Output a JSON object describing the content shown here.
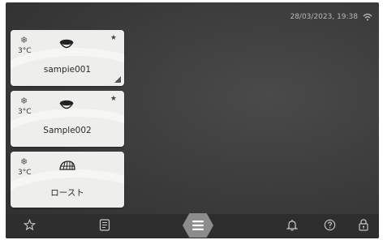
{
  "status_bar": {
    "datetime": "28/03/2023, 19:38",
    "connection_icon": "wifi-icon"
  },
  "cards": [
    {
      "temp": "3°C",
      "name": "sampie001",
      "icon": "bowl-icon",
      "favorite": true,
      "corner_marker": true
    },
    {
      "temp": "3°C",
      "name": "Sample002",
      "icon": "bowl-icon",
      "favorite": true,
      "corner_marker": false
    },
    {
      "temp": "3°C",
      "name": "ロースト",
      "icon": "roast-icon",
      "favorite": false,
      "corner_marker": false
    }
  ],
  "bottom_nav": {
    "left": [
      "star-icon",
      "recipe-book-icon"
    ],
    "center": "menu-icon",
    "right": [
      "bell-icon",
      "help-icon",
      "lock-icon"
    ]
  },
  "colors": {
    "background": "#3a3a3a",
    "card": "#eeeeec",
    "menu_button": "#8c8c8c"
  }
}
